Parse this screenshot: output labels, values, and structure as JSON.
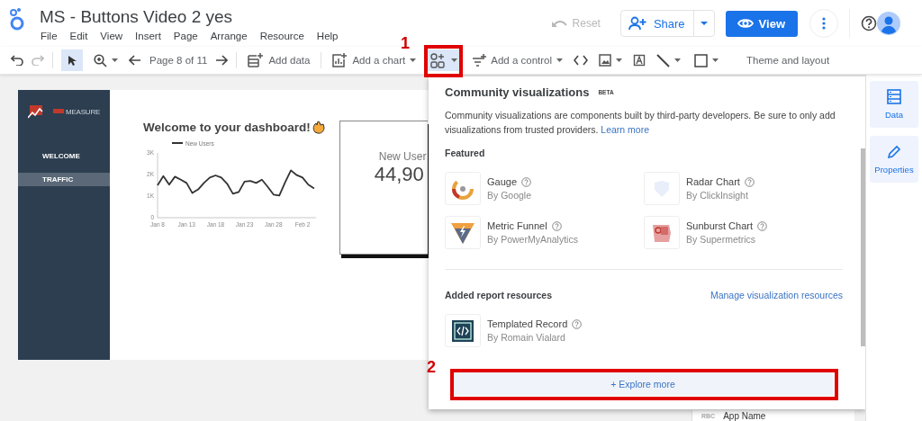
{
  "app": {
    "title": "MS - Buttons Video 2 yes",
    "menu": [
      "File",
      "Edit",
      "View",
      "Insert",
      "Page",
      "Arrange",
      "Resource",
      "Help"
    ]
  },
  "header_actions": {
    "reset": "Reset",
    "reset_disabled": true,
    "share": "Share",
    "view": "View"
  },
  "toolbar": {
    "select_selected": true,
    "page": "Page 8 of 11",
    "add_data": "Add data",
    "add_chart": "Add a chart",
    "community_selected": true,
    "add_control": "Add a control",
    "theme": "Theme and layout"
  },
  "report": {
    "logo": "MEASURE",
    "nav": [
      {
        "label": "WELCOME",
        "selected": false
      },
      {
        "label": "TRAFFIC",
        "selected": true
      }
    ],
    "heading": "Welcome to your dashboard!",
    "chart": {
      "chart_data": {
        "type": "line",
        "categories": [
          "Jan 8",
          null,
          null,
          null,
          null,
          "Jan 13",
          null,
          null,
          null,
          null,
          "Jan 18",
          null,
          null,
          null,
          null,
          "Jan 23",
          null,
          null,
          null,
          null,
          "Jan 28",
          null,
          null,
          null,
          null,
          "Feb 2",
          null,
          null
        ],
        "ylim": [
          0,
          3000
        ],
        "yticks": [
          {
            "value": 0,
            "label": "0"
          },
          {
            "value": 1000,
            "label": "1K"
          },
          {
            "value": 2000,
            "label": "2K"
          },
          {
            "value": 3000,
            "label": "3K"
          }
        ],
        "series": [
          {
            "name": "New Users",
            "color": "#333333",
            "values": [
              1500,
              1930,
              1530,
              1900,
              1760,
              1610,
              1140,
              1310,
              1610,
              1860,
              1960,
              1860,
              1570,
              1110,
              1190,
              1670,
              1700,
              1610,
              1760,
              1430,
              1070,
              1030,
              1640,
              2190,
              1970,
              1860,
              1530,
              1360
            ]
          }
        ]
      }
    },
    "scorecard": {
      "label": "New User",
      "value": "44,90"
    }
  },
  "popup": {
    "title": "Community visualizations",
    "badge": "BETA",
    "description": "Community visualizations are components built by third-party developers. Be sure to only add visualizations from trusted providers.",
    "link": "Learn more",
    "featured_heading": "Featured",
    "featured": [
      {
        "name": "Gauge",
        "author": "By Google",
        "kind": "gauge"
      },
      {
        "name": "Radar Chart",
        "author": "By ClickInsight",
        "kind": "radar"
      },
      {
        "name": "Metric Funnel",
        "author": "By PowerMyAnalytics",
        "kind": "funnel"
      },
      {
        "name": "Sunburst Chart",
        "author": "By Supermetrics",
        "kind": "sunburst"
      }
    ],
    "resources_heading": "Added report resources",
    "manage_link": "Manage visualization resources",
    "resources": [
      {
        "name": "Templated Record",
        "author": "By Romain Vialard",
        "kind": "code"
      }
    ],
    "explore": "+ Explore more"
  },
  "side_panel": [
    {
      "label": "Data",
      "kind": "data",
      "selected": false
    },
    {
      "label": "Properties",
      "kind": "properties",
      "selected": false
    }
  ],
  "field_list": [
    {
      "type": "RBC",
      "name": "App Name"
    }
  ],
  "annotations": [
    {
      "label": "1"
    },
    {
      "label": "2"
    }
  ]
}
